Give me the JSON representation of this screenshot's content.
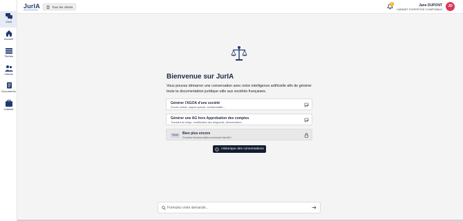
{
  "app": {
    "name": "JurIA"
  },
  "sidebar": {
    "items": [
      {
        "label": "Chat",
        "active": true,
        "icon": "chat-icon"
      },
      {
        "label": "Accueil",
        "active": false,
        "icon": "home-icon"
      },
      {
        "label": "Tâches",
        "active": false,
        "icon": "tasks-icon"
      },
      {
        "label": "Clients",
        "active": false,
        "icon": "clients-icon"
      },
      {
        "label": "Documents",
        "active": false,
        "icon": "documents-icon"
      },
      {
        "label": "Cabinet",
        "active": false,
        "icon": "cabinet-icon"
      }
    ]
  },
  "header": {
    "client_selector": "Tous les clients",
    "notifications_count": "0",
    "user": {
      "name": "Jane DUPONT",
      "role": "CABINET EXPERTISE COMPTABLE",
      "initials": "JD"
    }
  },
  "main": {
    "title": "Bienvenue sur JurIA",
    "intro": "Vous pouvez démarrer une conversation avec notre intelligence artificielle afin de générer toute la documentation juridique utile aux sociétés françaises.",
    "cards": [
      {
        "title": "Générer l'AGOA d'une société",
        "subtitle": "Procès verbal, rapport spécial, confidentialité,..."
      },
      {
        "title": "Générer une AG hors Approbation des comptes",
        "subtitle": "Transfert de siège, modification des dirigeants, dénomination..."
      },
      {
        "title": "Bien plus encore",
        "subtitle": "D'autres fonctionnalités arriveront bientôt !",
        "badge": "Soon",
        "disabled": true
      }
    ],
    "history_button": "Historique des conversations"
  },
  "prompt": {
    "placeholder": "Formulez votre demande..."
  },
  "colors": {
    "accent": "#1f3a6e",
    "avatar": "#d9365a",
    "badge": "#f5a623",
    "button": "#141d2f"
  }
}
